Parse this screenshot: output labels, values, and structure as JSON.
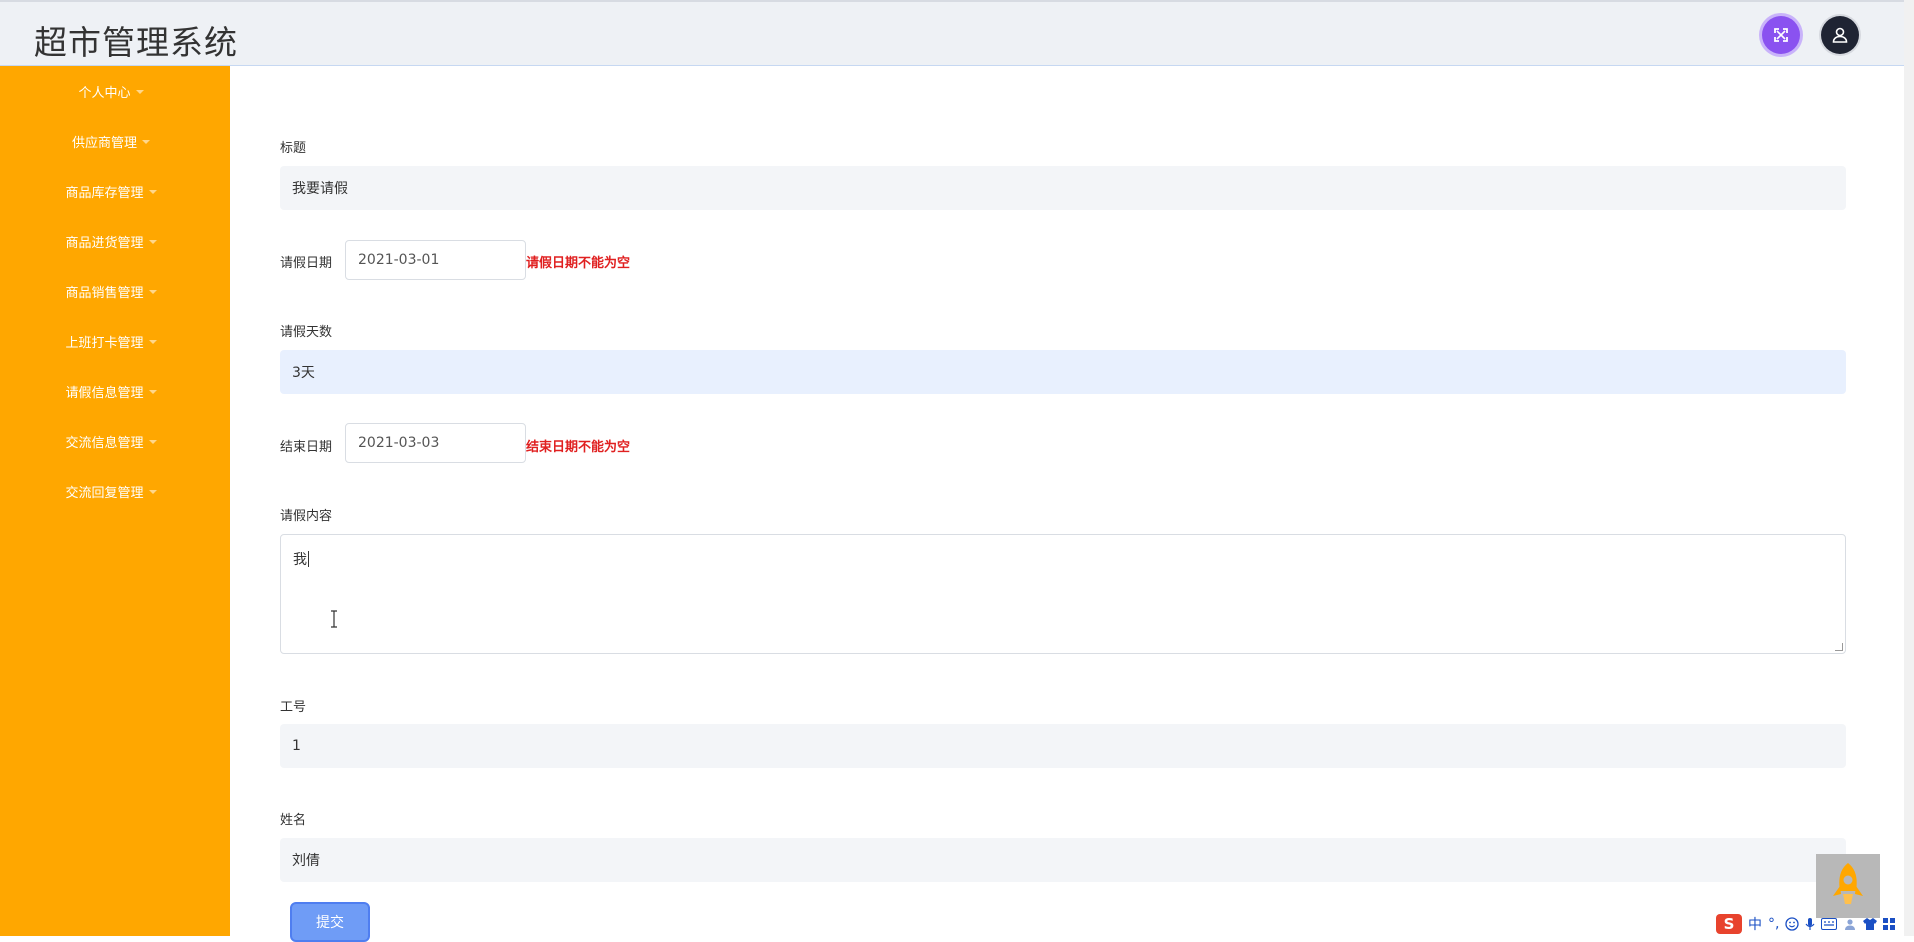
{
  "header": {
    "title": "超市管理系统",
    "icons": [
      "fullscreen-icon",
      "user-icon"
    ]
  },
  "sidebar": {
    "items": [
      {
        "label": "个人中心"
      },
      {
        "label": "供应商管理"
      },
      {
        "label": "商品库存管理"
      },
      {
        "label": "商品进货管理"
      },
      {
        "label": "商品销售管理"
      },
      {
        "label": "上班打卡管理"
      },
      {
        "label": "请假信息管理"
      },
      {
        "label": "交流信息管理"
      },
      {
        "label": "交流回复管理"
      }
    ]
  },
  "form": {
    "title_label": "标题",
    "title_value": "我要请假",
    "leave_date_label": "请假日期",
    "leave_date_value": "2021-03-01",
    "leave_date_error": "请假日期不能为空",
    "days_label": "请假天数",
    "days_value": "3天",
    "end_date_label": "结束日期",
    "end_date_value": "2021-03-03",
    "end_date_error": "结束日期不能为空",
    "content_label": "请假内容",
    "content_value": "我",
    "employee_id_label": "工号",
    "employee_id_value": "1",
    "name_label": "姓名",
    "name_value": "刘倩",
    "submit_label": "提交"
  },
  "tray": {
    "ime_mode": "中",
    "punct": "°,"
  },
  "colors": {
    "sidebar_bg": "#ffa700",
    "error_text": "#e02020",
    "submit_bg": "#6f9cf6",
    "fullscreen_bg": "#8a52f0"
  }
}
